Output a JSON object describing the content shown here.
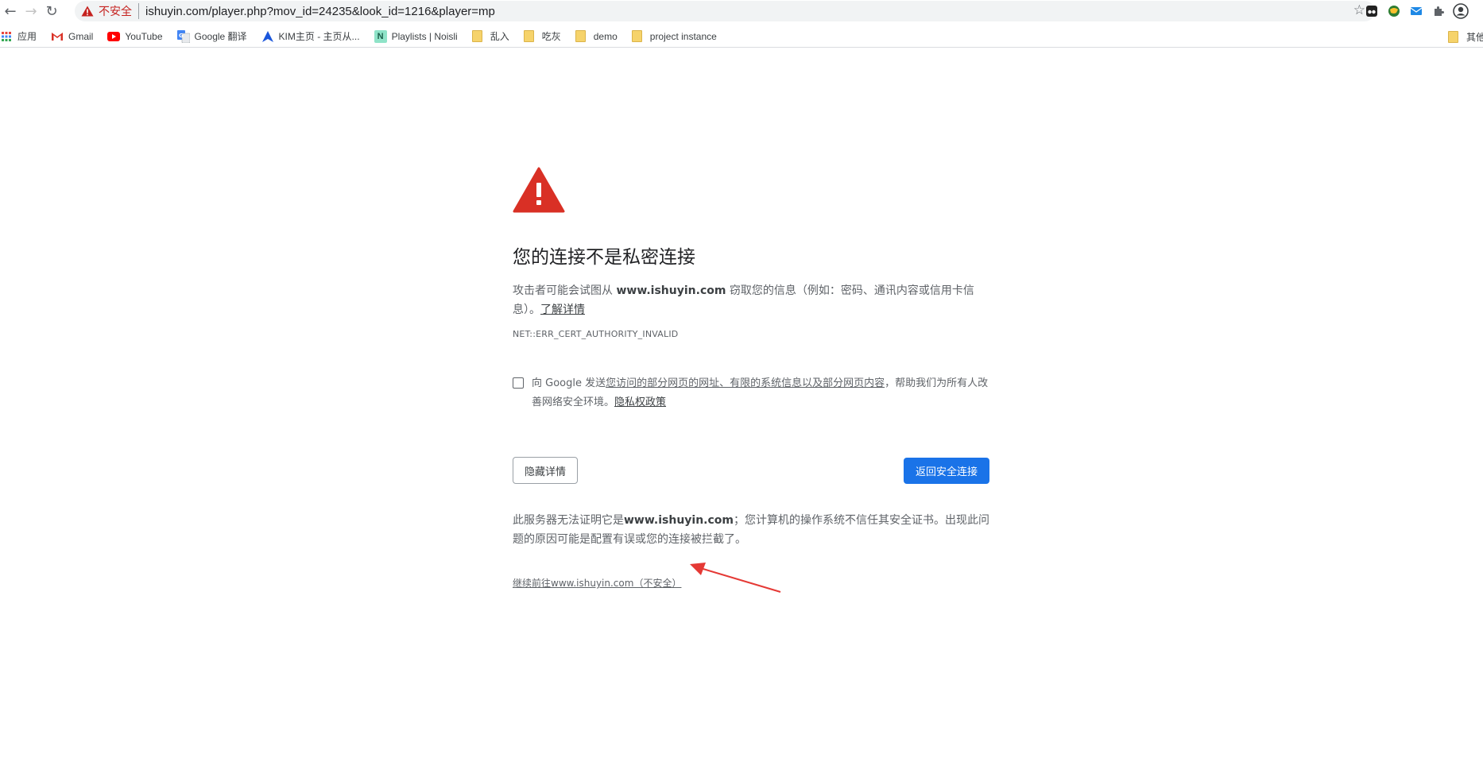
{
  "browser": {
    "security_label": "不安全",
    "url": "ishuyin.com/player.php?mov_id=24235&look_id=1216&player=mp",
    "back_icon": "back-arrow-icon",
    "forward_icon": "forward-arrow-icon",
    "reload_icon": "reload-icon",
    "bookmark_star_icon": "star-icon",
    "extensions": [
      "tampermonkey-icon",
      "globe-extension-icon",
      "mail-extension-icon",
      "puzzle-icon",
      "profile-icon"
    ]
  },
  "bookmarks": {
    "items": [
      {
        "label": "应用",
        "icon": "apps-grid-icon"
      },
      {
        "label": "Gmail",
        "icon": "gmail-icon"
      },
      {
        "label": "YouTube",
        "icon": "youtube-icon"
      },
      {
        "label": "Google 翻译",
        "icon": "google-translate-icon"
      },
      {
        "label": "KIM主页 - 主页从...",
        "icon": "kim-icon"
      },
      {
        "label": "Playlists | Noisli",
        "icon": "noisli-icon"
      },
      {
        "label": "乱入",
        "icon": "folder-icon"
      },
      {
        "label": "吃灰",
        "icon": "folder-icon"
      },
      {
        "label": "demo",
        "icon": "folder-icon"
      },
      {
        "label": "project instance",
        "icon": "folder-icon"
      }
    ],
    "other_label": "其他"
  },
  "interstitial": {
    "title": "您的连接不是私密连接",
    "desc_prefix": "攻击者可能会试图从 ",
    "desc_domain": "www.ishuyin.com",
    "desc_suffix": " 窃取您的信息（例如：密码、通讯内容或信用卡信息）。",
    "learn_more": "了解详情",
    "error_code": "NET::ERR_CERT_AUTHORITY_INVALID",
    "optin_prefix": "向 Google 发送",
    "optin_link": "您访问的部分网页的网址、有限的系统信息以及部分网页内容",
    "optin_suffix": "，帮助我们为所有人改善网络安全环境。",
    "privacy_link": "隐私权政策",
    "hide_details_button": "隐藏详情",
    "back_to_safety_button": "返回安全连接",
    "details_prefix": "此服务器无法证明它是",
    "details_domain": "www.ishuyin.com",
    "details_suffix": "；您计算机的操作系统不信任其安全证书。出现此问题的原因可能是配置有误或您的连接被拦截了。",
    "proceed_link": "继续前往www.ishuyin.com（不安全）"
  },
  "colors": {
    "warning_red": "#d93025",
    "primary_blue": "#1a73e8",
    "annotation_arrow": "#e53935"
  }
}
